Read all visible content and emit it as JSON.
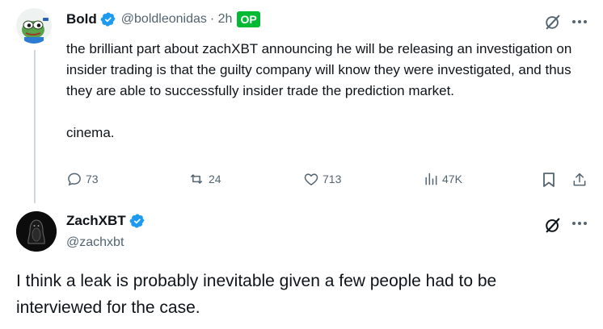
{
  "reply_tweet": {
    "display_name": "Bold",
    "handle": "@boldleonidas",
    "time": "· 2h",
    "op_badge": "OP",
    "text_lines": [
      "the brilliant part about zachXBT announcing he will be releasing an investigation on insider trading is that the guilty company will know they were investigated, and thus they are able to successfully insider trade the prediction market.",
      "cinema."
    ],
    "metrics": {
      "replies": "73",
      "reposts": "24",
      "likes": "713",
      "views": "47K"
    }
  },
  "main_tweet": {
    "display_name": "ZachXBT",
    "handle": "@zachxbt",
    "text": "I think a leak is probably inevitable given a few people had to be interviewed for the case."
  },
  "colors": {
    "text": "#0f1419",
    "secondary": "#536471",
    "verified": "#1d9bf0",
    "op_badge": "#00ba34",
    "thread_line": "#cfd9de"
  },
  "icons": [
    "grok-icon",
    "more-icon",
    "reply-icon",
    "repost-icon",
    "like-icon",
    "views-icon",
    "bookmark-icon",
    "share-icon",
    "verified-icon"
  ]
}
